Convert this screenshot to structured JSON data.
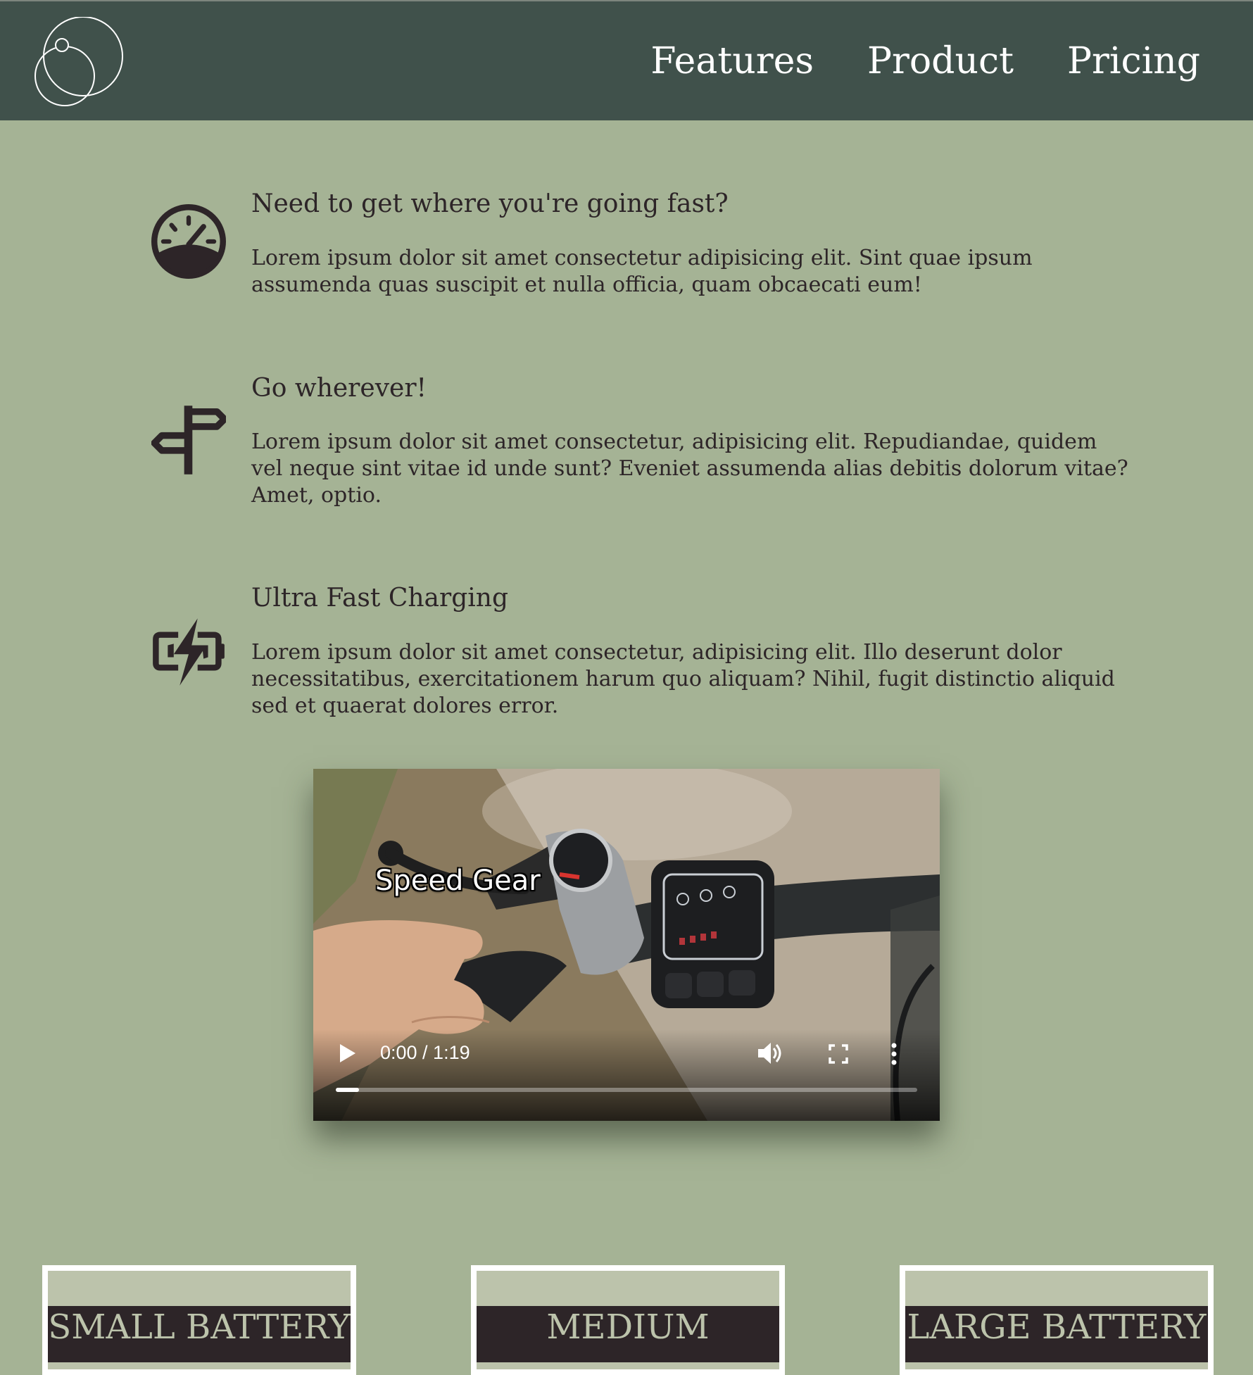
{
  "nav": {
    "items": [
      "Features",
      "Product",
      "Pricing"
    ]
  },
  "features": [
    {
      "icon": "speedometer-icon",
      "title": "Need to get where you're going fast?",
      "body": "Lorem ipsum dolor sit amet consectetur adipisicing elit. Sint quae ipsum assumenda quas suscipit et nulla officia, quam obcaecati eum!"
    },
    {
      "icon": "signpost-icon",
      "title": "Go wherever!",
      "body": "Lorem ipsum dolor sit amet consectetur, adipisicing elit. Repudiandae, quidem vel neque sint vitae id unde sunt? Eveniet assumenda alias debitis dolorum vitae? Amet, optio."
    },
    {
      "icon": "battery-charging-icon",
      "title": "Ultra Fast Charging",
      "body": "Lorem ipsum dolor sit amet consectetur, adipisicing elit. Illo deserunt dolor necessitatibus, exercitationem harum quo aliquam? Nihil, fugit distinctio aliquid sed et quaerat dolores error."
    }
  ],
  "video": {
    "caption": "Speed Gear",
    "time": "0:00 / 1:19",
    "progress": 0.04
  },
  "pricing": {
    "cards": [
      "SMALL BATTERY",
      "MEDIUM",
      "LARGE BATTERY"
    ]
  },
  "colors": {
    "header_bg": "#40514b",
    "page_bg": "#a5b395",
    "text": "#2d2528",
    "card_band": "#2d2528",
    "card_bg": "#bcc3ab"
  }
}
